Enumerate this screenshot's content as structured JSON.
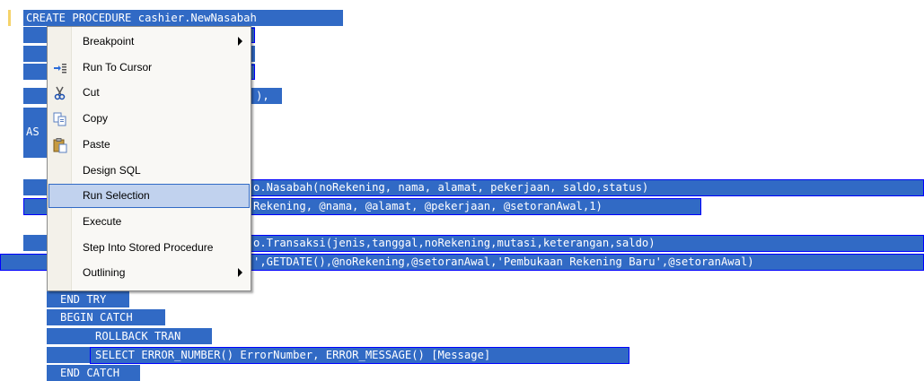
{
  "code_lines": [
    {
      "text": "CREATE PROCEDURE cashier.NewNasabah"
    },
    {
      "text": "AS"
    },
    {
      "text": "o.Nasabah(noRekening, nama, alamat, pekerjaan, saldo,status)"
    },
    {
      "text": "Rekening, @nama, @alamat, @pekerjaan, @setoranAwal,1)"
    },
    {
      "text": "o.Transaksi(jenis,tanggal,noRekening,mutasi,keterangan,saldo)"
    },
    {
      "text": "',GETDATE(),@noRekening,@setoranAwal,'Pembukaan Rekening Baru',@setoranAwal)"
    },
    {
      "text": "END TRY"
    },
    {
      "text": "BEGIN CATCH"
    },
    {
      "text": "ROLLBACK TRAN"
    },
    {
      "text": "SELECT ERROR_NUMBER() ErrorNumber, ERROR_MESSAGE() [Message]"
    },
    {
      "text": "END CATCH"
    },
    {
      "text": "),"
    }
  ],
  "context_menu": {
    "items": [
      {
        "label": "Breakpoint",
        "icon": null,
        "submenu": true
      },
      {
        "label": "Run To Cursor",
        "icon": "run-to-cursor-icon",
        "submenu": false
      },
      {
        "label": "Cut",
        "icon": "cut-icon",
        "submenu": false
      },
      {
        "label": "Copy",
        "icon": "copy-icon",
        "submenu": false
      },
      {
        "label": "Paste",
        "icon": "paste-icon",
        "submenu": false
      },
      {
        "label": "Design SQL",
        "icon": null,
        "submenu": false
      },
      {
        "label": "Run Selection",
        "icon": null,
        "submenu": false,
        "highlighted": true
      },
      {
        "label": "Execute",
        "icon": null,
        "submenu": false
      },
      {
        "label": "Step Into Stored Procedure",
        "icon": null,
        "submenu": false
      },
      {
        "label": "Outlining",
        "icon": null,
        "submenu": true
      }
    ]
  },
  "colors": {
    "selection": "#316ac5",
    "menu_highlight": "#c1d2ee",
    "box_border": "#0000ff"
  }
}
